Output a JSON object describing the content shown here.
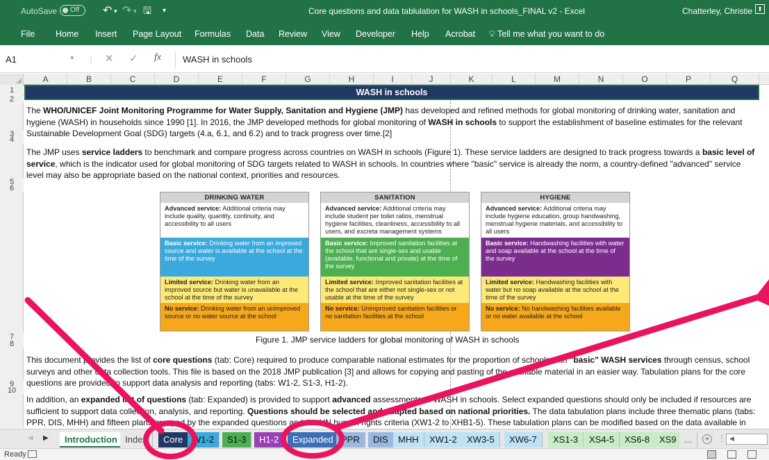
{
  "titlebar": {
    "autosave": "AutoSave",
    "autosave_state": "Off",
    "title": "Core questions and data tablulation for WASH in schools_FINAL v2  -  Excel",
    "user": "Chatterley, Christie"
  },
  "ribbon": {
    "tabs": [
      "File",
      "Home",
      "Insert",
      "Page Layout",
      "Formulas",
      "Data",
      "Review",
      "View",
      "Developer",
      "Help",
      "Acrobat"
    ],
    "tell_me": "Tell me what you want to do"
  },
  "formula_bar": {
    "name_box": "A1",
    "fx": "fx",
    "value": "WASH in schools"
  },
  "columns": [
    "A",
    "B",
    "C",
    "D",
    "E",
    "F",
    "G",
    "H",
    "I",
    "J",
    "K",
    "L",
    "M",
    "N",
    "O",
    "P",
    "Q"
  ],
  "rows": [
    "1",
    "2",
    "3",
    "4",
    "5",
    "6",
    "7",
    "8",
    "9",
    "10"
  ],
  "sheet": {
    "banner": "WASH in schools",
    "caption": "Figure 1. JMP service ladders for global monitoring of WASH in schools",
    "p1": {
      "a": "The ",
      "b": "WHO/UNICEF Joint Monitoring Programme for Water Supply, Sanitation and Hygiene (JMP)",
      "c": " has developed and refined methods for global monitoring of drinking water, sanitation and hygiene (WASH) in households since 1990 [1]. In 2016, the JMP developed methods for global monitoring of ",
      "d": "WASH in schools",
      "e": " to support the establishment of baseline estimates for the relevant Sustainable Development Goal (SDG) targets (4.a, 6.1, and 6.2) and to track progress over time.[2]"
    },
    "p2": {
      "a": "The JMP uses ",
      "b": "service ladders",
      "c": " to benchmark and compare progress across countries on WASH in schools (Figure 1). These service ladders are designed to track progress towards a ",
      "d": "basic level of service",
      "e": ", which is the indicator used for global monitoring of SDG targets related to WASH in schools. In countries where \"basic\" service is already the norm, a country-defined \"advanced\" service level may also be appropriate based on the national context, priorities and resources."
    },
    "p3": {
      "a": "This document provides the list of ",
      "b": "core questions",
      "c": " (tab: Core) required to produce comparable national estimates for the proportion of schools with ",
      "d": "\"basic\" WASH services",
      "e": " through census, school surveys and other data collection tools. This file is based on the 2018 JMP publication [3] and allows for copying and pasting of the available material in an easier way. Tabulation plans for the core questions are provided to support data analysis and reporting (tabs: W1-2, S1-3, H1-2)."
    },
    "p4": {
      "a": "In addition, an ",
      "b": "expanded list of questions",
      "c": " (tab: Expanded) is provided to support ",
      "d": "advanced",
      "e": " assessments of WASH in schools. Select expanded questions should only be included if resources are sufficient to support data collection, analysis, and reporting. ",
      "f": "Questions should be selected and adapted based on national priorities.",
      "g": " The data tabulation plans include three thematic plans (tabs: PPR, DIS, MHH) and fifteen plans grouped by the expanded questions and the UN human rights criteria (XW1-2 to XHB1-5). These tabulation plans can be modified based on the data available in each country."
    }
  },
  "ladders": [
    {
      "title": "DRINKING WATER",
      "advanced": {
        "key": "Advanced service:",
        "text": " Additional criteria may include quality, quantity, continuity, and accessibility to all users"
      },
      "basic": {
        "key": "Basic service:",
        "text": " Drinking water from an improved source and water is available at the school at the time of the survey"
      },
      "limited": {
        "key": "Limited service:",
        "text": " Drinking water from an improved source but water is unavailable at the school at the time of the survey"
      },
      "none": {
        "key": "No service:",
        "text": " Drinking water from an unimproved source or no water source at the school"
      },
      "basic_color": "#3aa9dd"
    },
    {
      "title": "SANITATION",
      "advanced": {
        "key": "Advanced service:",
        "text": " Additional criteria may include student per toilet ratios, menstrual hygiene facilities, cleanliness, accessibility to all users, and excreta management systems"
      },
      "basic": {
        "key": "Basic service:",
        "text": " Improved sanitation facilities at the school that are single-sex and usable (available, functional and private) at the time of the survey"
      },
      "limited": {
        "key": "Limited service:",
        "text": " Improved sanitation facilities at the school that are either not single-sex or not usable at the time of the survey"
      },
      "none": {
        "key": "No service:",
        "text": " Unimproved sanitation facilities or no sanitation facilities at the school"
      },
      "basic_color": "#4caf50"
    },
    {
      "title": "HYGIENE",
      "advanced": {
        "key": "Advanced service:",
        "text": " Additional criteria may include hygiene education, group handwashing, menstrual hygiene materials, and accessibility to all users"
      },
      "basic": {
        "key": "Basic service:",
        "text": " Handwashing facilities with water and soap available at the school  at the time of the survey"
      },
      "limited": {
        "key": "Limited service:",
        "text": " Handwashing facilities with water but no soap available at the school at the time of the survey"
      },
      "none": {
        "key": "No service:",
        "text": " No handwashing facilities available or no water available at the school"
      },
      "basic_color": "#7b2d8e"
    }
  ],
  "ladder_colors": {
    "limited": "#fde978",
    "none": "#f6a81c",
    "advanced": "#ffffff"
  },
  "sheet_tabs": [
    {
      "label": "Introduction",
      "active": true,
      "bg": "#ffffff",
      "fg": "#217346"
    },
    {
      "label": "Index",
      "active": false,
      "bg": "#e8e8e8",
      "fg": "#444444"
    },
    {
      "label": "Core",
      "active": false,
      "bg": "#1f3864",
      "fg": "#ffffff"
    },
    {
      "label": "W1-2",
      "active": false,
      "bg": "#3aa9dd",
      "fg": "#111111"
    },
    {
      "label": "S1-3",
      "active": false,
      "bg": "#4caf50",
      "fg": "#111111"
    },
    {
      "label": "H1-2",
      "active": false,
      "bg": "#9b3fb5",
      "fg": "#ffffff"
    },
    {
      "label": "Expanded",
      "active": false,
      "bg": "#3b6fb6",
      "fg": "#ffffff"
    },
    {
      "label": "PPR",
      "active": false,
      "bg": "#9ab8e0",
      "fg": "#111111"
    },
    {
      "label": "DIS",
      "active": false,
      "bg": "#9ab8e0",
      "fg": "#111111"
    },
    {
      "label": "MHH",
      "active": false,
      "bg": "#bfe3f5",
      "fg": "#111111"
    },
    {
      "label": "XW1-2",
      "active": false,
      "bg": "#bfe3f5",
      "fg": "#111111"
    },
    {
      "label": "XW3-5",
      "active": false,
      "bg": "#bfe3f5",
      "fg": "#111111"
    },
    {
      "label": "XW6-7",
      "active": false,
      "bg": "#bfe3f5",
      "fg": "#111111"
    },
    {
      "label": "XS1-3",
      "active": false,
      "bg": "#c8ecc8",
      "fg": "#111111"
    },
    {
      "label": "XS4-5",
      "active": false,
      "bg": "#c8ecc8",
      "fg": "#111111"
    },
    {
      "label": "XS6-8",
      "active": false,
      "bg": "#c8ecc8",
      "fg": "#111111"
    },
    {
      "label": "XS9",
      "active": false,
      "bg": "#c8ecc8",
      "fg": "#111111"
    },
    {
      "label": "...",
      "active": false,
      "bg": "#e8e8e8",
      "fg": "#444444"
    }
  ],
  "status": {
    "ready": "Ready"
  },
  "colors": {
    "excel_green": "#217346",
    "banner_navy": "#1f3864",
    "annotation_pink": "#e8155e"
  }
}
